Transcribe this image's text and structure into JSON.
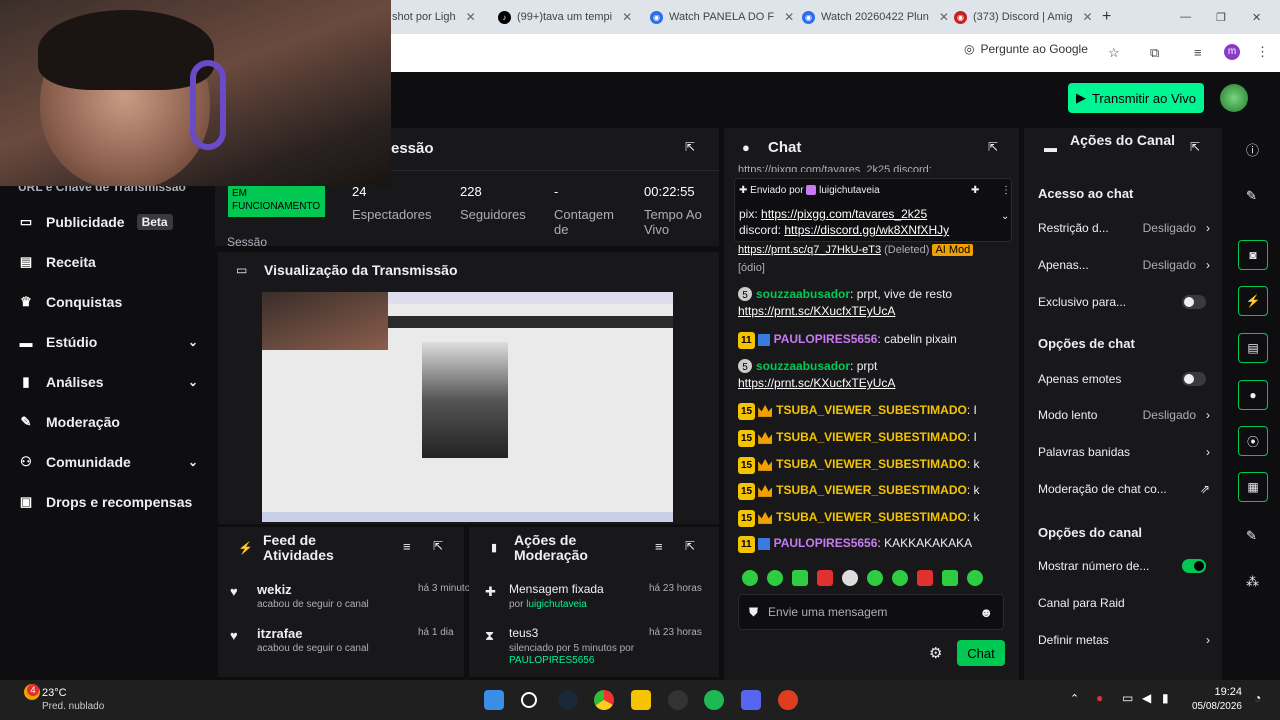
{
  "browser": {
    "tabs": [
      {
        "label": "shot por Ligh"
      },
      {
        "label": "(99+)tava um tempi"
      },
      {
        "label": "Watch PANELA DO F"
      },
      {
        "label": "Watch 20260422 Plun"
      },
      {
        "label": "(373) Discord | Amig"
      }
    ],
    "ask_google": "Pergunte ao Google"
  },
  "header": {
    "go_live": "Transmitir ao Vivo"
  },
  "sidebar": {
    "partial_item": "URL e Chave de Transmissão",
    "items": [
      {
        "label": "Publicidade",
        "badge": "Beta"
      },
      {
        "label": "Receita"
      },
      {
        "label": "Conquistas"
      },
      {
        "label": "Estúdio"
      },
      {
        "label": "Análises"
      },
      {
        "label": "Moderação"
      },
      {
        "label": "Comunidade"
      },
      {
        "label": "Drops e recompensas"
      }
    ]
  },
  "session": {
    "title": "essão",
    "status": "EM FUNCIONAMENTO",
    "status_label": "Sessão",
    "stats": [
      {
        "value": "24",
        "label": "Espectadores"
      },
      {
        "value": "228",
        "label": "Seguidores"
      },
      {
        "value": "-",
        "label": "Contagem de"
      },
      {
        "value": "00:22:55",
        "label": "Tempo Ao Vivo"
      }
    ]
  },
  "preview": {
    "title": "Visualização da Transmissão"
  },
  "feed": {
    "title": "Feed de Atividades",
    "items": [
      {
        "user": "wekiz",
        "time": "há 3 minutos",
        "action": "acabou de seguir o canal"
      },
      {
        "user": "itzrafae",
        "time": "há 1 dia",
        "action": "acabou de seguir o canal"
      }
    ]
  },
  "mod_actions": {
    "title": "Ações de Moderação",
    "items": [
      {
        "title": "Mensagem fixada",
        "time": "há 23 horas",
        "by": "por",
        "user": "luigichutaveia"
      },
      {
        "title": "teus3",
        "time": "há 23 horas",
        "by": "silenciado por 5 minutos por",
        "user": "PAULOPIRES5656"
      }
    ]
  },
  "chat": {
    "title": "Chat",
    "top_partial": "https://pixgg.com/tavares_2k25 discord:",
    "pinned": {
      "label": "Enviado por",
      "user": "luigichutaveia",
      "pix_label": "pix:",
      "pix_link": "https://pixgg.com/tavares_2k25",
      "discord_label": "discord:",
      "discord_link": "https://discord.gg/wk8XNfXHJy"
    },
    "deleted_line": {
      "link": "https://prnt.sc/q7_J7HkU-eT3",
      "deleted": "(Deleted)",
      "tag": "AI Mod",
      "extra": "[ódio]"
    },
    "messages": [
      {
        "badge": "5",
        "user": "souzzaabusador",
        "text": "prpt, vive de resto",
        "link": "https://prnt.sc/KXucfxTEyUcA",
        "color": "#00c853"
      },
      {
        "badge": "11",
        "user": "PAULOPIRES5656",
        "text": "cabelin pixain",
        "color": "#c87bf0"
      },
      {
        "badge": "5",
        "user": "souzzaabusador",
        "text": "prpt",
        "link": "https://prnt.sc/KXucfxTEyUcA",
        "color": "#00c853"
      },
      {
        "badge": "15",
        "user": "TSUBA_VIEWER_SUBESTIMADO",
        "text": "I",
        "color": "#f5c400"
      },
      {
        "badge": "15",
        "user": "TSUBA_VIEWER_SUBESTIMADO",
        "text": "I",
        "color": "#f5c400"
      },
      {
        "badge": "15",
        "user": "TSUBA_VIEWER_SUBESTIMADO",
        "text": "k",
        "color": "#f5c400"
      },
      {
        "badge": "15",
        "user": "TSUBA_VIEWER_SUBESTIMADO",
        "text": "k",
        "color": "#f5c400"
      },
      {
        "badge": "15",
        "user": "TSUBA_VIEWER_SUBESTIMADO",
        "text": "k",
        "color": "#f5c400"
      },
      {
        "badge": "11",
        "user": "PAULOPIRES5656",
        "text": "KAKKAKAKAKA",
        "color": "#c87bf0"
      }
    ],
    "placeholder": "Envie uma mensagem",
    "send": "Chat"
  },
  "channel_actions": {
    "title": "Ações do Canal",
    "sections": [
      {
        "title": "Acesso ao chat"
      },
      {
        "title": "Opções de chat"
      },
      {
        "title": "Opções do canal"
      }
    ],
    "rows": {
      "restricao": {
        "label": "Restrição d...",
        "value": "Desligado"
      },
      "apenas": {
        "label": "Apenas...",
        "value": "Desligado"
      },
      "exclusivo": {
        "label": "Exclusivo para..."
      },
      "apenas_emotes": {
        "label": "Apenas emotes"
      },
      "modo_lento": {
        "label": "Modo lento",
        "value": "Desligado"
      },
      "palavras": {
        "label": "Palavras banidas"
      },
      "moderacao": {
        "label": "Moderação de chat co..."
      },
      "mostrar": {
        "label": "Mostrar número de..."
      },
      "raid": {
        "label": "Canal para Raid"
      },
      "metas": {
        "label": "Definir metas"
      }
    }
  },
  "taskbar": {
    "weather_temp": "23°C",
    "weather_desc": "Pred. nublado",
    "weather_badge": "4",
    "time": "19:24",
    "date": "05/08/2026"
  },
  "colors": {
    "accent": "#00f593",
    "green": "#00c853",
    "bg": "#0e0e10",
    "panel": "#18181b"
  }
}
